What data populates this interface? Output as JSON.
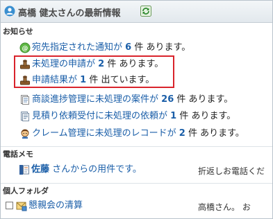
{
  "header": {
    "title": "高橋 健太さんの最新情報"
  },
  "sections": {
    "notices": "お知らせ",
    "phone_memo": "電話メモ",
    "personal_folder": "個人フォルダ"
  },
  "notices": [
    {
      "link": "宛先指定された通知が",
      "count": "6",
      "unit": "件",
      "suffix": "あります。",
      "icon": "notification-icon"
    },
    {
      "link": "未処理の申請が",
      "count": "2",
      "unit": "件",
      "suffix": "あります。",
      "icon": "workflow-icon"
    },
    {
      "link": "申請結果が",
      "count": "1",
      "unit": "件",
      "suffix": "出ています。",
      "icon": "workflow-result-icon"
    },
    {
      "link": "商談進捗管理に未処理の案件が",
      "count": "26",
      "unit": "件",
      "suffix": "あります。",
      "icon": "deal-progress-icon"
    },
    {
      "link": "見積り依頼受付に未処理の依頼が",
      "count": "1",
      "unit": "件",
      "suffix": "あります。",
      "icon": "estimate-request-icon"
    },
    {
      "link": "クレーム管理に未処理のレコードが",
      "count": "2",
      "unit": "件",
      "suffix": "あります。",
      "icon": "claim-management-icon"
    }
  ],
  "phone_memo": {
    "name": "佐藤",
    "text": "さんからの用件です。",
    "note": "折返しお電話くだ"
  },
  "personal_folder": {
    "item": "懇親会の清算",
    "note": "高橋さん。 お"
  },
  "colors": {
    "link": "#1a5ea8",
    "highlight": "#d9232b",
    "header_bg": "#e8edf1"
  }
}
